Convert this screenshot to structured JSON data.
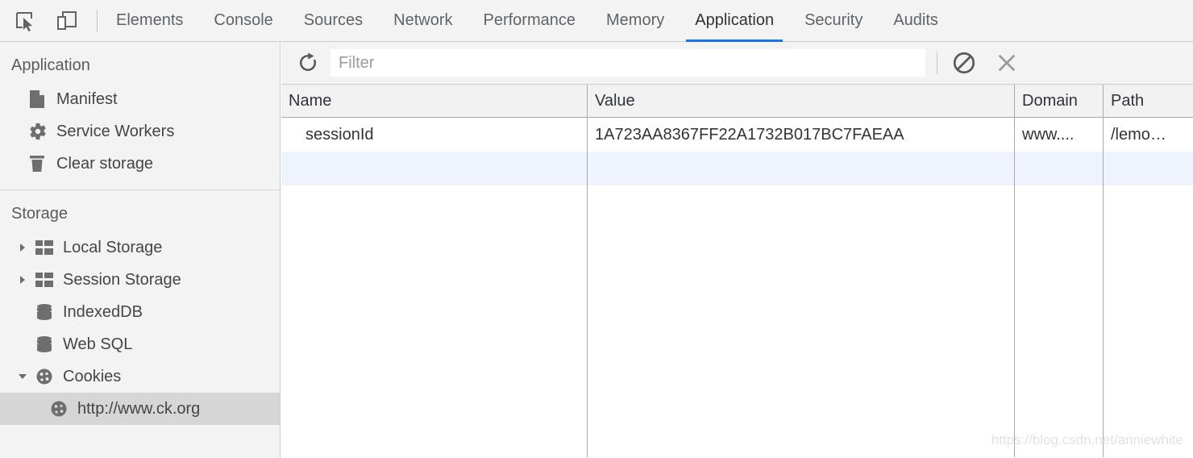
{
  "devtools": {
    "toolbar_icons": [
      {
        "name": "inspect-element-icon",
        "label": "Inspect element"
      },
      {
        "name": "device-toolbar-icon",
        "label": "Toggle device toolbar"
      }
    ],
    "tabs": [
      {
        "label": "Elements",
        "active": false
      },
      {
        "label": "Console",
        "active": false
      },
      {
        "label": "Sources",
        "active": false
      },
      {
        "label": "Network",
        "active": false
      },
      {
        "label": "Performance",
        "active": false
      },
      {
        "label": "Memory",
        "active": false
      },
      {
        "label": "Application",
        "active": true
      },
      {
        "label": "Security",
        "active": false
      },
      {
        "label": "Audits",
        "active": false
      }
    ],
    "active_tab": "Application",
    "accent_color": "#1a73e8"
  },
  "sidebar": {
    "sections": [
      {
        "title": "Application",
        "items": [
          {
            "label": "Manifest",
            "icon": "document-icon",
            "arrow": "none",
            "selected": false
          },
          {
            "label": "Service Workers",
            "icon": "gear-icon",
            "arrow": "none",
            "selected": false
          },
          {
            "label": "Clear storage",
            "icon": "trash-icon",
            "arrow": "none",
            "selected": false
          }
        ]
      },
      {
        "title": "Storage",
        "items": [
          {
            "label": "Local Storage",
            "icon": "table-icon",
            "arrow": "collapsed",
            "selected": false
          },
          {
            "label": "Session Storage",
            "icon": "table-icon",
            "arrow": "collapsed",
            "selected": false
          },
          {
            "label": "IndexedDB",
            "icon": "database-icon",
            "arrow": "none",
            "selected": false
          },
          {
            "label": "Web SQL",
            "icon": "database-icon",
            "arrow": "none",
            "selected": false
          },
          {
            "label": "Cookies",
            "icon": "cookie-icon",
            "arrow": "expanded",
            "selected": false
          },
          {
            "label": "http://www.ck.org",
            "icon": "cookie-icon",
            "arrow": "none",
            "selected": true,
            "child": true
          }
        ]
      }
    ]
  },
  "panel": {
    "toolbar": {
      "refresh_icon": "refresh-icon",
      "filter": {
        "value": "",
        "placeholder": "Filter"
      },
      "clear_all_icon": "clear-all-cookies-icon",
      "delete_selected_icon": "delete-selected-icon"
    },
    "table": {
      "columns": [
        "Name",
        "Value",
        "Domain",
        "Path"
      ],
      "rows": [
        {
          "Name": "sessionId",
          "Value": "1A723AA8367FF22A1732B017BC7FAEAA",
          "Domain": "www....",
          "Path": "/lemo…"
        },
        {
          "Name": "",
          "Value": "",
          "Domain": "",
          "Path": ""
        }
      ]
    }
  },
  "watermark": "https://blog.csdn.net/anniewhite"
}
